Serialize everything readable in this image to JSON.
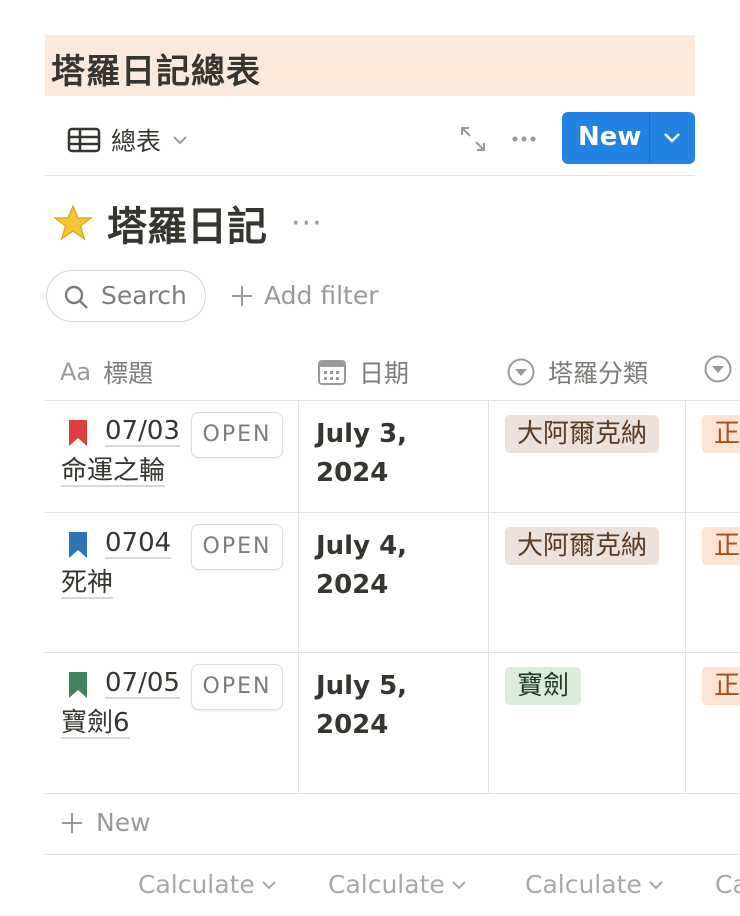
{
  "banner": {
    "title": "塔羅日記總表"
  },
  "view": {
    "tab_label": "總表",
    "new_label": "New"
  },
  "database": {
    "title": "塔羅日記"
  },
  "toolbar": {
    "search_label": "Search",
    "add_filter_label": "Add filter"
  },
  "columns": [
    {
      "prefix": "Aa",
      "label": "標題"
    },
    {
      "label": "日期"
    },
    {
      "label": "塔羅分類"
    }
  ],
  "rows": [
    {
      "title_line1": "07/03",
      "title_line2": "命運之輪",
      "open": "OPEN",
      "date_line1": "July 3,",
      "date_line2": "2024",
      "category": "大阿爾克納",
      "category_color": "#eee0da",
      "category_text_color": "#5c3b23",
      "next_tag": "正",
      "bookmark_color": "#e03e3e"
    },
    {
      "title_line1": "0704",
      "title_line2": "死神",
      "open": "OPEN",
      "date_line1": "July 4,",
      "date_line2": "2024",
      "category": "大阿爾克納",
      "category_color": "#eee0da",
      "category_text_color": "#5c3b23",
      "next_tag": "正",
      "bookmark_color": "#2e75b8"
    },
    {
      "title_line1": "07/05",
      "title_line2": "寶劍6",
      "open": "OPEN",
      "date_line1": "July 5,",
      "date_line2": "2024",
      "category": "寶劍",
      "category_color": "#dbeddb",
      "category_text_color": "#1c3829",
      "next_tag": "正",
      "bookmark_color": "#448361"
    }
  ],
  "footer": {
    "new_label": "New",
    "calculate": [
      "Calculate",
      "Calculate",
      "Calculate",
      "Ca"
    ]
  }
}
